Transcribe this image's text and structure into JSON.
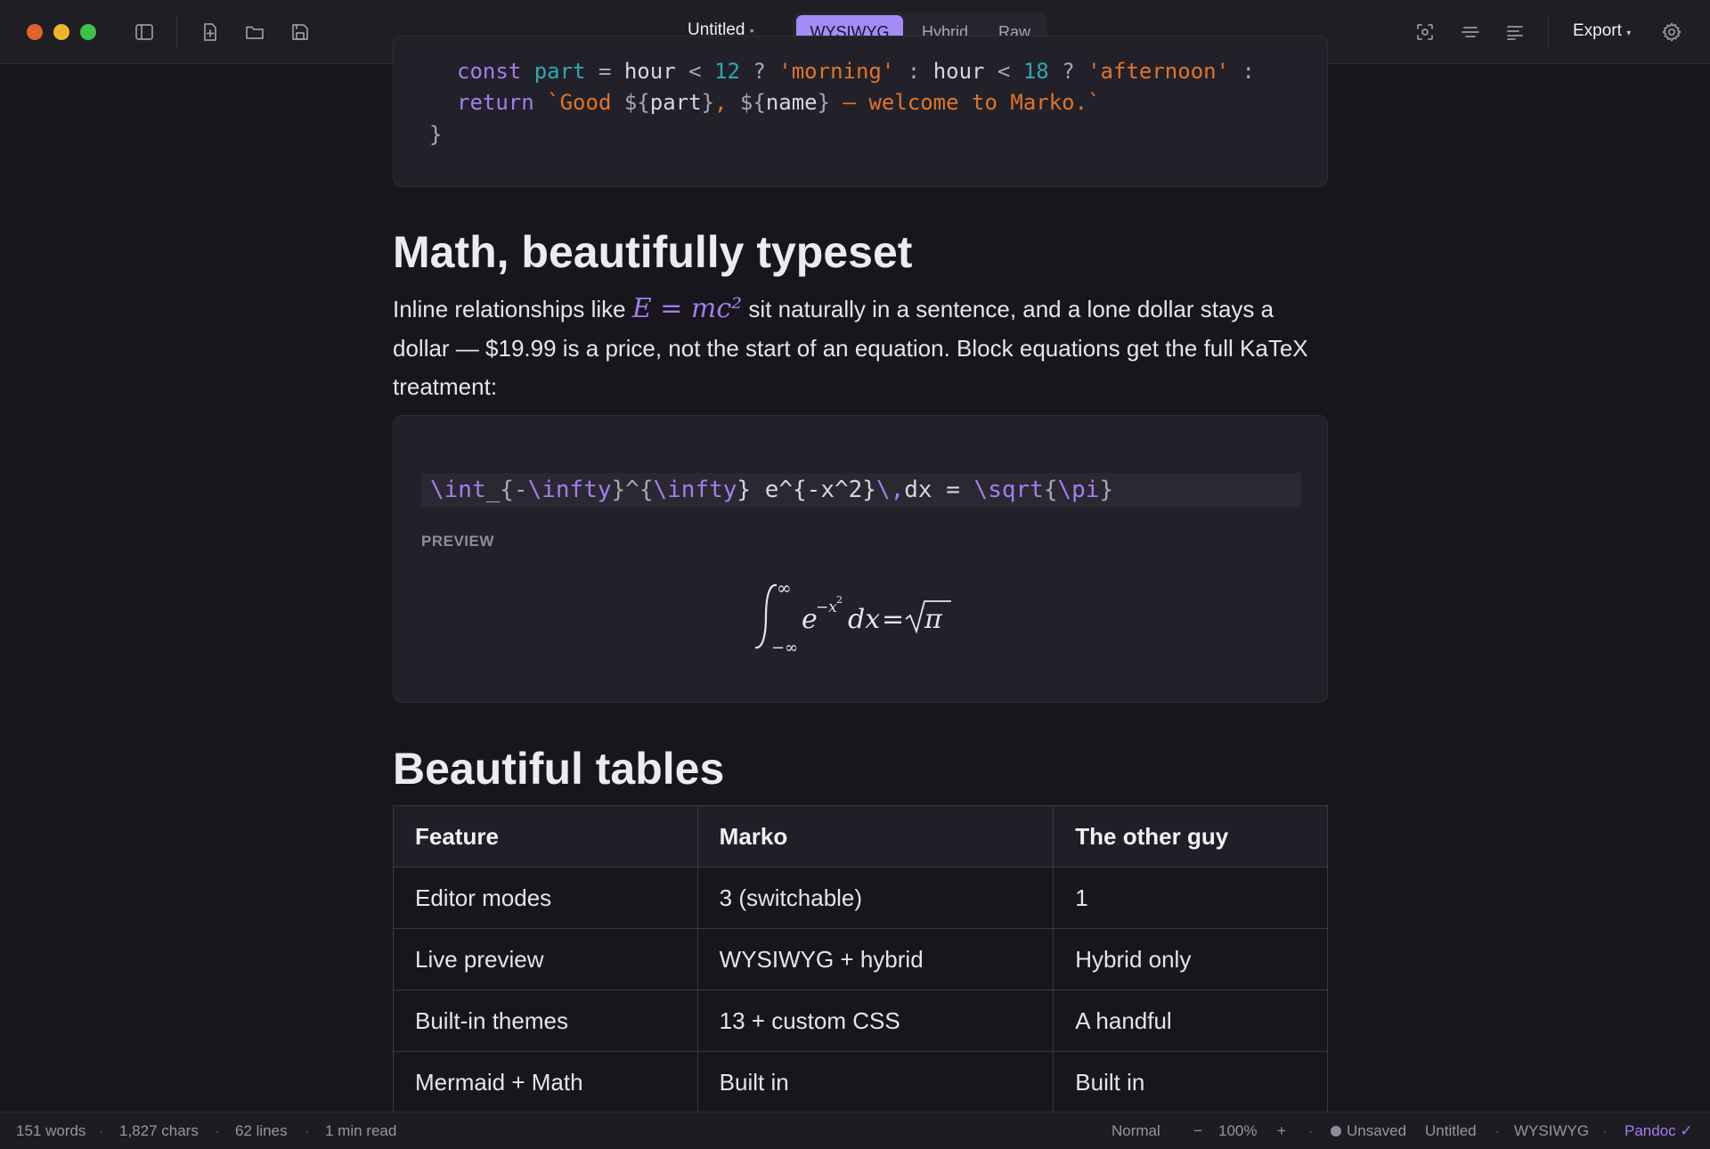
{
  "titlebar": {
    "doc_title": "Untitled",
    "doc_dirty_marker": "•",
    "modes": [
      "WYSIWYG",
      "Hybrid",
      "Raw"
    ],
    "active_mode": "WYSIWYG",
    "export_label": "Export",
    "export_caret": "▾"
  },
  "code": {
    "line1": {
      "kw": "const",
      "var": "part",
      "eq": " = ",
      "hour1": "hour",
      "lt1": " < ",
      "n1": "12",
      "q1": " ? ",
      "s1": "'morning'",
      "c1": " : ",
      "hour2": "hour",
      "lt2": " < ",
      "n2": "18",
      "q2": " ? ",
      "s2": "'afternoon'",
      "c2": " :"
    },
    "line2": {
      "kw": "return",
      "s_open": " `Good ",
      "i1_open": "${",
      "i1": "part",
      "i1_close": "}",
      "s_mid": ", ",
      "i2_open": "${",
      "i2": "name",
      "i2_close": "}",
      "s_end": " — welcome to Marko.`"
    },
    "line3": "}"
  },
  "math_section": {
    "heading": "Math, beautifully typeset",
    "para_before": "Inline relationships like ",
    "inline_math": "E = mc²",
    "para_after": " sit naturally in a sentence, and a lone dollar stays a dollar — $19.99 is a price, not the start of an equation. Block equations get the full KaTeX treatment:",
    "latex_source": {
      "t1": "\\int",
      "t2": "_{-",
      "t3": "\\infty",
      "t4": "}^{",
      "t5": "\\infty",
      "t6": "} e^{-x^2}",
      "t7": "\\,",
      "t8": "dx = ",
      "t9": "\\sqrt",
      "t10": "{",
      "t11": "\\pi",
      "t12": "}"
    },
    "preview_label": "PREVIEW"
  },
  "tables_section": {
    "heading": "Beautiful tables",
    "columns": [
      "Feature",
      "Marko",
      "The other guy"
    ],
    "rows": [
      [
        "Editor modes",
        "3 (switchable)",
        "1"
      ],
      [
        "Live preview",
        "WYSIWYG + hybrid",
        "Hybrid only"
      ],
      [
        "Built-in themes",
        "13 + custom CSS",
        "A handful"
      ],
      [
        "Mermaid + Math",
        "Built in",
        "Built in"
      ]
    ]
  },
  "statusbar": {
    "words": "151 words",
    "chars": "1,827 chars",
    "lines": "62 lines",
    "read": "1 min read",
    "paragraph_style": "Normal",
    "zoom_out": "−",
    "zoom": "100%",
    "zoom_in": "+",
    "save_state": "Unsaved",
    "file": "Untitled",
    "mode": "WYSIWYG",
    "export_format": "Pandoc ✓"
  },
  "colors": {
    "accent": "#a48bf6",
    "keyword": "#a47cf0",
    "number": "#2fa7b5",
    "string": "#e0742a",
    "close": "#e0632a",
    "minimize": "#f0b429",
    "maximize": "#3cc24a"
  },
  "icons": [
    "sidebar-icon",
    "new-file-icon",
    "open-folder-icon",
    "save-icon",
    "focus-icon",
    "format-icon",
    "outline-icon",
    "settings-gear-icon"
  ]
}
